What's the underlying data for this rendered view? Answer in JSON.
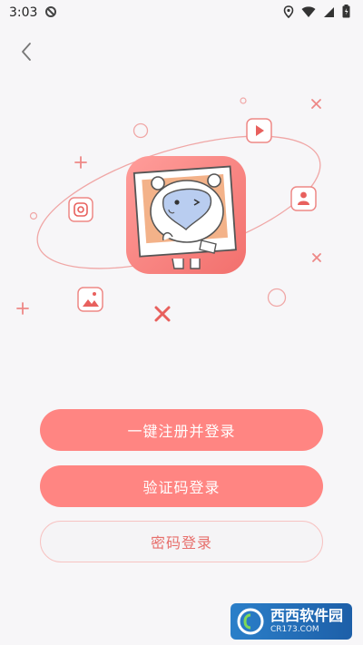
{
  "status_bar": {
    "time": "3:03"
  },
  "buttons": {
    "one_click": "一键注册并登录",
    "sms": "验证码登录",
    "password": "密码登录"
  },
  "watermark": {
    "title": "西西软件园",
    "subtitle": "CR173.COM"
  },
  "colors": {
    "accent": "#ff8582",
    "outline_text": "#e76f6c",
    "background": "#f7f6f8"
  }
}
